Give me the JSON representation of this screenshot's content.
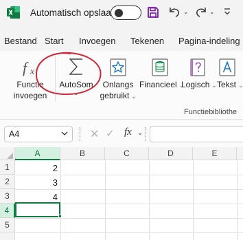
{
  "titlebar": {
    "app_icon": "excel-logo-icon",
    "autosave_label": "Automatisch opslaan",
    "autosave_state": "off",
    "colors": {
      "excel_green": "#107c41",
      "save_purple": "#7719aa"
    }
  },
  "tabs": [
    "Bestand",
    "Start",
    "Invoegen",
    "Tekenen",
    "Pagina-indeling"
  ],
  "ribbon": {
    "group_label": "Functiebibliothe",
    "buttons": {
      "functie_invoegen": {
        "line1": "Functie",
        "line2": "invoegen",
        "icon": "fx-icon"
      },
      "autosom": {
        "label": "AutoSom",
        "chevron": "⌄",
        "icon": "sigma-icon"
      },
      "onlangs": {
        "line1": "Onlangs",
        "line2": "gebruikt",
        "chevron": "⌄",
        "icon": "star-icon"
      },
      "financieel": {
        "label": "Financieel",
        "chevron": "⌄",
        "icon": "coins-database-icon"
      },
      "logisch": {
        "label": "Logisch",
        "chevron": "⌄",
        "icon": "question-book-icon"
      },
      "tekst": {
        "label": "Tekst",
        "chevron": "⌄",
        "icon": "text-a-icon"
      }
    },
    "highlight_color": "#d2263a"
  },
  "formula_bar": {
    "name_box": "A4",
    "cancel_symbol": "✕",
    "enter_symbol": "✓",
    "fx_symbol": "fx",
    "fx_dropdown": "⌄",
    "formula": ""
  },
  "grid": {
    "columns": [
      "A",
      "B",
      "C",
      "D",
      "E"
    ],
    "rows": [
      "1",
      "2",
      "3",
      "4",
      "5"
    ],
    "cells": {
      "A1": "2",
      "A2": "3",
      "A3": "4"
    },
    "active_cell": "A4"
  }
}
